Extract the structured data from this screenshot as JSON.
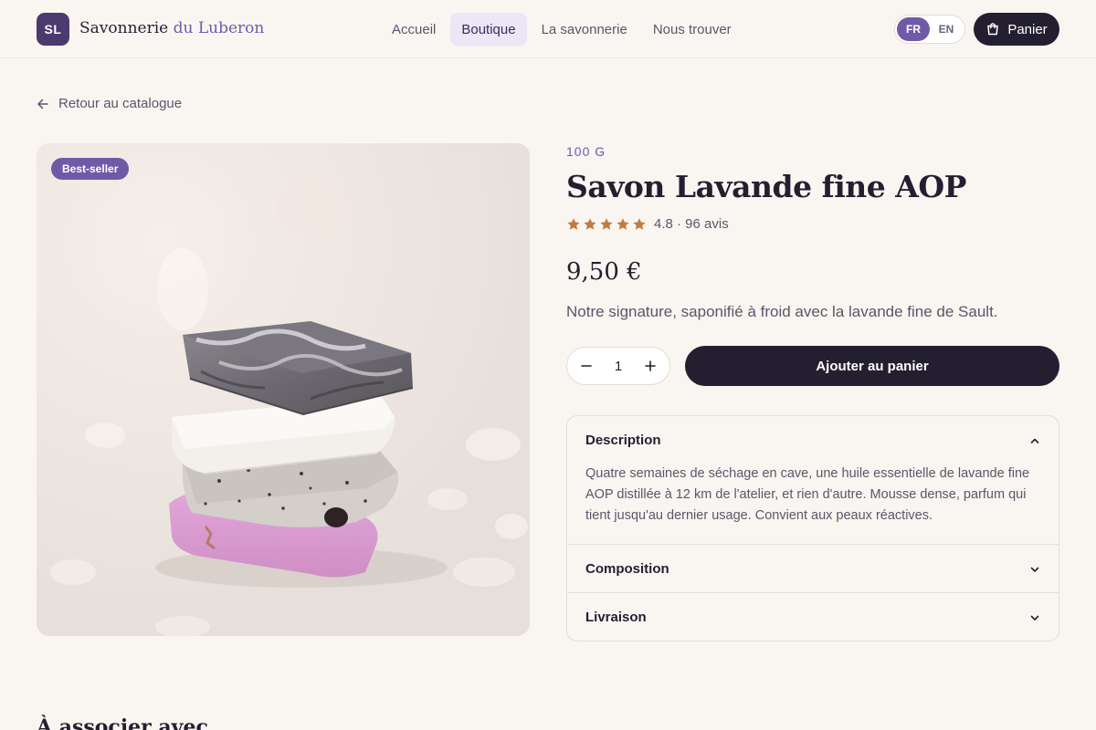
{
  "header": {
    "logo_initials": "SL",
    "brand_name": "Savonnerie",
    "brand_accent": "du Luberon",
    "nav": [
      "Accueil",
      "Boutique",
      "La savonnerie",
      "Nous trouver"
    ],
    "nav_active": "Boutique",
    "languages": [
      "FR",
      "EN"
    ],
    "language_active": "FR",
    "cart_label": "Panier"
  },
  "back_link": "Retour au catalogue",
  "product": {
    "badge": "Best-seller",
    "weight": "100 G",
    "title": "Savon Lavande fine AOP",
    "rating_stars": 5,
    "rating_text": "4.8 · 96 avis",
    "price": "9,50 €",
    "tagline": "Notre signature, saponifié à froid avec la lavande fine de Sault.",
    "quantity": "1",
    "add_to_cart": "Ajouter au panier"
  },
  "accordion": [
    {
      "title": "Description",
      "expanded": true,
      "body": "Quatre semaines de séchage en cave, une huile essentielle de lavande fine AOP distillée à 12 km de l'atelier, et rien d'autre. Mousse dense, parfum qui tient jusqu'au dernier usage. Convient aux peaux réactives."
    },
    {
      "title": "Composition",
      "expanded": false
    },
    {
      "title": "Livraison",
      "expanded": false
    }
  ],
  "related_title": "À associer avec",
  "colors": {
    "accent": "#6f5aa8",
    "dark": "#241f30",
    "star": "#c47a3f",
    "background": "#f9f6f1"
  }
}
